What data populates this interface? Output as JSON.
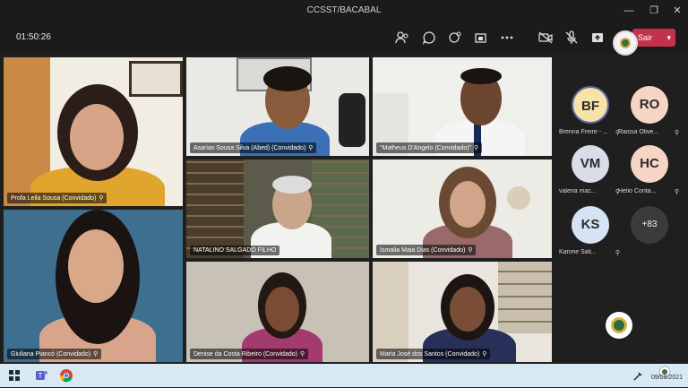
{
  "window": {
    "title": "CCSST/BACABAL"
  },
  "toolbar": {
    "timer": "01:50:26",
    "leave_label": "Sair",
    "buttons": [
      "people-icon",
      "chat-icon",
      "reactions-icon",
      "share-tray-icon",
      "more-icon",
      "camera-off-icon",
      "mic-off-icon",
      "share-icon"
    ]
  },
  "tiles": [
    {
      "name": "Profa Leila Sousa (Convidado)"
    },
    {
      "name": "Asarias Sousa Silva (Abed) (Convidado)"
    },
    {
      "name": "\"Matheus D'Angelo (Convidado)\""
    },
    {
      "name": "NATALINO SALGADO FILHO"
    },
    {
      "name": "Ismalia Maia Dias (Convidado)"
    },
    {
      "name": "Giuliana Piancó (Convidado)"
    },
    {
      "name": "Denise da Costa Ribeiro (Convidado)"
    },
    {
      "name": "Maria José dos Santos (Convidado)"
    }
  ],
  "roster": [
    {
      "initials": "BF",
      "label": "Brenna Freire - ...",
      "color": "#f6e3a7"
    },
    {
      "initials": "RO",
      "label": "Raissa Olive...",
      "color": "#f6d5c5"
    },
    {
      "initials": "VM",
      "label": "valeria mac...",
      "color": "#d9dde8"
    },
    {
      "initials": "HC",
      "label": "Helio Conta...",
      "color": "#f6d5c5"
    },
    {
      "initials": "KS",
      "label": "Karime Sali...",
      "color": "#d5e3f4"
    }
  ],
  "roster_more": "+83",
  "taskbar": {
    "date": "09/08/2021"
  },
  "colors": {
    "leave": "#c4314b",
    "accent": "#6264a7",
    "taskbar": "#d9e9f4"
  }
}
